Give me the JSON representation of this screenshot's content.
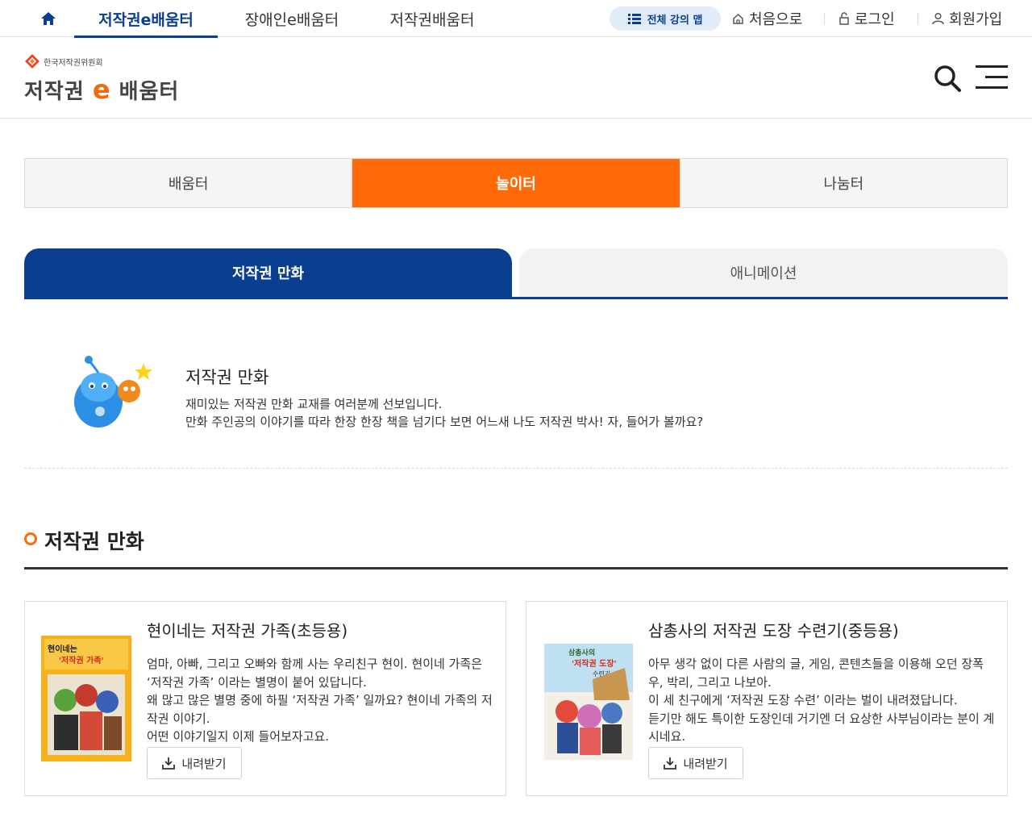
{
  "topbar": {
    "nav": [
      "저작권e배움터",
      "장애인e배움터",
      "저작권배움터"
    ],
    "map_label": "전체 강의 맵",
    "util": [
      "처음으로",
      "로그인",
      "회원가입"
    ]
  },
  "header": {
    "org_name": "한국저작권위원회",
    "logo_pre": "저작권",
    "logo_e": "e",
    "logo_post": "배움터"
  },
  "main_tabs": [
    "배움터",
    "놀이터",
    "나눔터"
  ],
  "sub_tabs": [
    "저작권 만화",
    "애니메이션"
  ],
  "intro": {
    "title": "저작권 만화",
    "line1": "재미있는 저작권 만화 교재를 여러분께 선보입니다.",
    "line2": "만화 주인공의 이야기를 따라 한장 한장 책을 넘기다 보면 어느새 나도 저작권 박사! 자, 들어가 볼까요?"
  },
  "section_title": "저작권 만화",
  "cards": [
    {
      "title": "현이네는 저작권 가족(초등용)",
      "desc1": "엄마, 아빠, 그리고 오빠와 함께 사는 우리친구 현이. 현이네 가족은 ‘저작권 가족’ 이라는 별명이 붙어 있답니다.",
      "desc2": "왜 많고 많은 별명 중에 하필 ‘저작권 가족’ 일까요? 현이네 가족의 저작권 이야기.",
      "desc3": "어떤 이야기일지 이제 들어보자고요.",
      "button": "내려받기",
      "cover_line1": "현이네는",
      "cover_line2": "'저작권 가족'"
    },
    {
      "title": "삼총사의 저작권 도장 수련기(중등용)",
      "desc1": "아무 생각 없이 다른 사람의 글, 게임, 콘텐츠들을 이용해 오던 장폭우, 박리, 그리고 나보아.",
      "desc2": "이 세 친구에게 ‘저작권 도장 수련’ 이라는 벌이 내려졌답니다.",
      "desc3": "듣기만 해도 특이한 도장인데 거기엔 더 요상한 사부님이라는 분이 계시네요.",
      "button": "내려받기",
      "cover_line1": "삼총사의",
      "cover_line2": "'저작권 도장'",
      "cover_line3": "수련기"
    }
  ],
  "colors": {
    "navy": "#0a3f8f",
    "orange": "#ff6a0b"
  },
  "icons": [
    "home-icon",
    "list-icon",
    "house-outline-icon",
    "lock-icon",
    "user-icon",
    "search-icon",
    "menu-icon",
    "download-icon"
  ]
}
